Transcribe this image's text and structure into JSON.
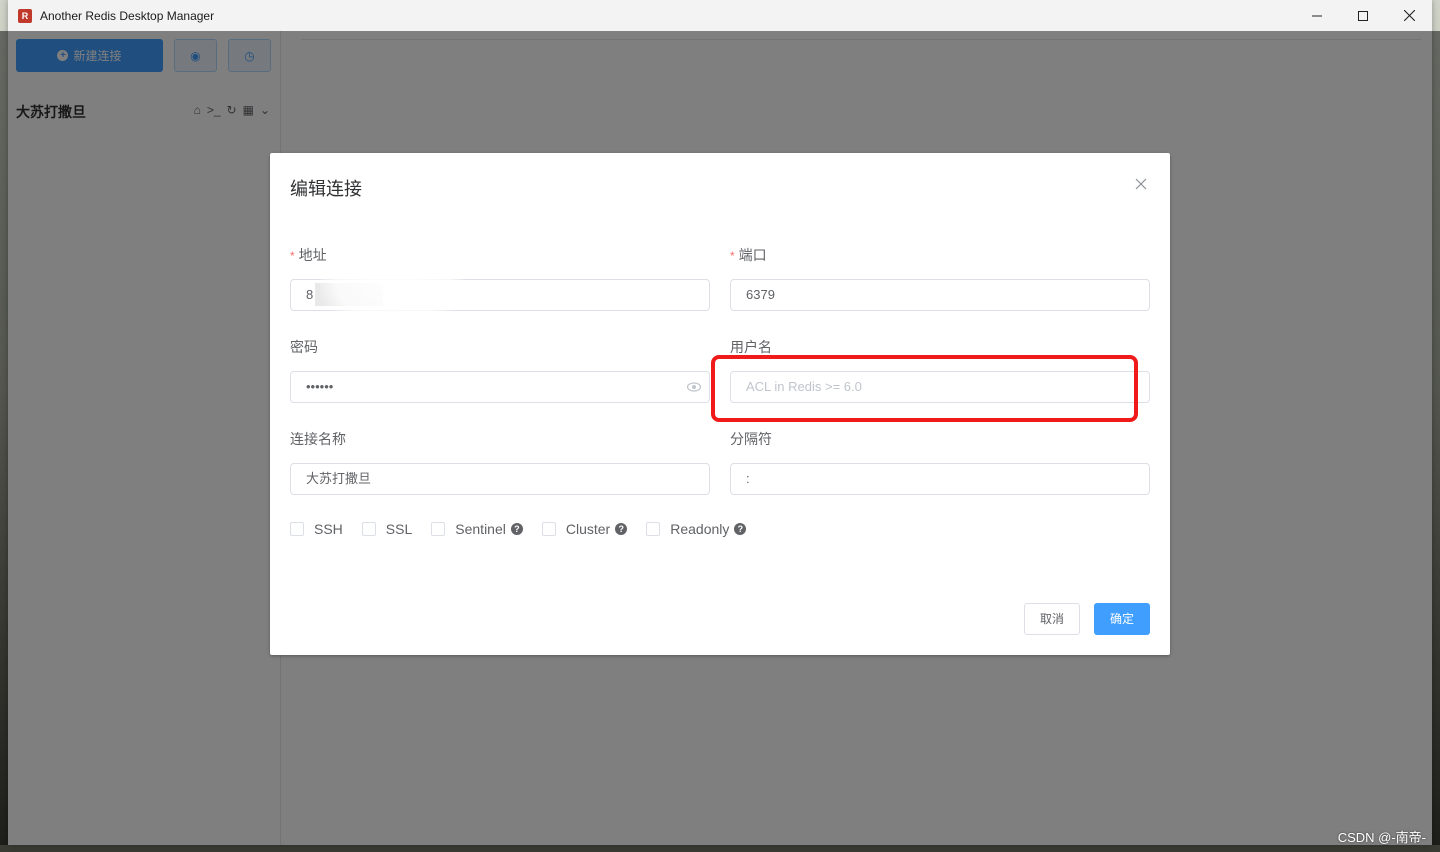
{
  "window": {
    "title": "Another Redis Desktop Manager",
    "icon": "redis-app-icon",
    "controls": [
      "minimize",
      "maximize",
      "close"
    ]
  },
  "sidebar": {
    "new_connection_label": "新建连接",
    "connection_name": "大苏打撒旦"
  },
  "dialog": {
    "title": "编辑连接",
    "address": {
      "label": "地址",
      "value": "8",
      "required": true
    },
    "port": {
      "label": "端口",
      "value": "6379",
      "required": true
    },
    "password": {
      "label": "密码",
      "value": "••••••"
    },
    "username": {
      "label": "用户名",
      "value": "",
      "placeholder": "ACL in Redis >= 6.0"
    },
    "connection_name": {
      "label": "连接名称",
      "value": "大苏打撒旦"
    },
    "separator": {
      "label": "分隔符",
      "value": ":"
    },
    "options": [
      {
        "label": "SSH",
        "checked": false,
        "help": false
      },
      {
        "label": "SSL",
        "checked": false,
        "help": false
      },
      {
        "label": "Sentinel",
        "checked": false,
        "help": true
      },
      {
        "label": "Cluster",
        "checked": false,
        "help": true
      },
      {
        "label": "Readonly",
        "checked": false,
        "help": true
      }
    ],
    "cancel_label": "取消",
    "ok_label": "确定"
  },
  "watermark": "CSDN @-南帝-",
  "colors": {
    "primary": "#409eff",
    "highlight_box": "#f01a1a",
    "required_asterisk": "#f56c6c"
  }
}
